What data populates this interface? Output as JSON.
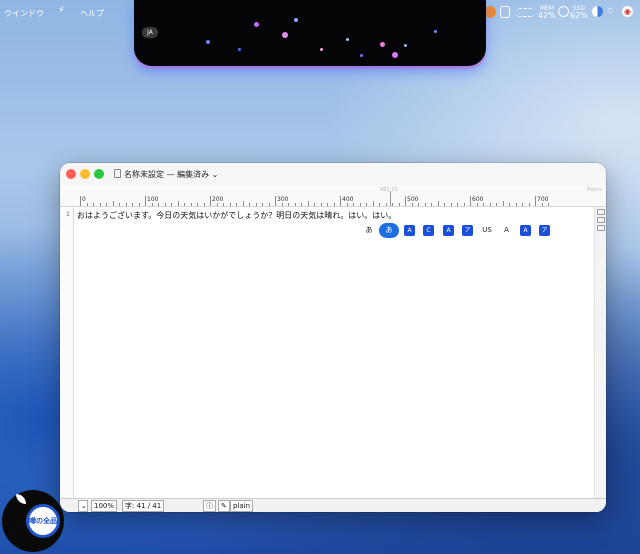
{
  "menubar": {
    "items": [
      "ウインドウ",
      "ヘルプ"
    ],
    "app_glyph": "⚡",
    "stats": [
      {
        "label": "MEM",
        "value": "42%"
      },
      {
        "label": "SSD",
        "value": "62%"
      }
    ],
    "notch_badge": "JA"
  },
  "window": {
    "title": "名称未設定 — 編集済み",
    "title_chevron": "⌄",
    "ruler": {
      "unit": "Points",
      "position": "482.33",
      "labels": [
        "0",
        "100",
        "200",
        "300",
        "400",
        "500",
        "600",
        "700"
      ]
    },
    "line_number": "1",
    "text": "おはようございます。今日の天気はいかがでしょうか？明日の天気は晴れ。はい。はい。",
    "input_modes": [
      "あ",
      "あ",
      "A",
      "C",
      "A",
      "ア",
      "US",
      "A",
      "A",
      "ア"
    ],
    "status": {
      "zoom": "100%",
      "char_count": "字: 41 / 41",
      "info_icon": "ⓘ",
      "mode": "plain"
    }
  },
  "badge": {
    "text": "噂の全品"
  },
  "colors": {
    "accent": "#1b4fd9",
    "close": "#ff5f57",
    "minimize": "#febc2e",
    "zoom": "#28c840"
  }
}
